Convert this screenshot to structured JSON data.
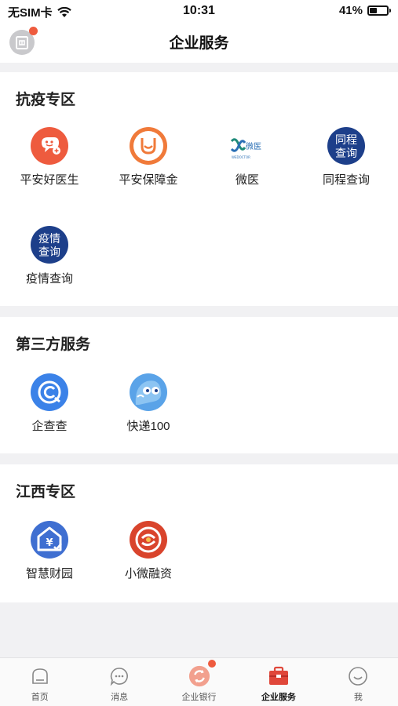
{
  "status_bar": {
    "carrier": "无SIM卡",
    "time": "10:31",
    "battery_pct_text": "41%",
    "battery_level": 0.41
  },
  "nav": {
    "title": "企业服务"
  },
  "sections": [
    {
      "title": "抗疫专区",
      "items": [
        {
          "label": "平安好医生",
          "icon": "pingan-doctor-icon"
        },
        {
          "label": "平安保障金",
          "icon": "pingan-bag-icon"
        },
        {
          "label": "微医",
          "icon": "weiyi-icon",
          "logo_text": "微医",
          "logo_sub": "WEDOCTOR"
        },
        {
          "label": "同程查询",
          "icon": "tongcheng-query-icon",
          "logo_text": [
            "同程",
            "查询"
          ]
        },
        {
          "label": "疫情查询",
          "icon": "epidemic-query-icon",
          "logo_text": [
            "疫情",
            "查询"
          ]
        }
      ]
    },
    {
      "title": "第三方服务",
      "items": [
        {
          "label": "企查查",
          "icon": "qichacha-icon"
        },
        {
          "label": "快递100",
          "icon": "kuaidi100-icon"
        }
      ]
    },
    {
      "title": "江西专区",
      "items": [
        {
          "label": "智慧财园",
          "icon": "smart-park-icon",
          "logo_text": "¥"
        },
        {
          "label": "小微融资",
          "icon": "micro-finance-icon"
        }
      ]
    }
  ],
  "tab_bar": [
    {
      "label": "首页",
      "icon": "home-icon",
      "active": false
    },
    {
      "label": "消息",
      "icon": "message-icon",
      "active": false
    },
    {
      "label": "企业银行",
      "icon": "corporate-bank-icon",
      "active": false,
      "badge": true
    },
    {
      "label": "企业服务",
      "icon": "briefcase-icon",
      "active": true
    },
    {
      "label": "我",
      "icon": "smiley-icon",
      "active": false
    }
  ],
  "colors": {
    "accent_red": "#ee5b3e",
    "orange": "#f07a3a",
    "navy": "#1d3f8a",
    "blue": "#3b82e8",
    "background": "#f1f1f3"
  }
}
